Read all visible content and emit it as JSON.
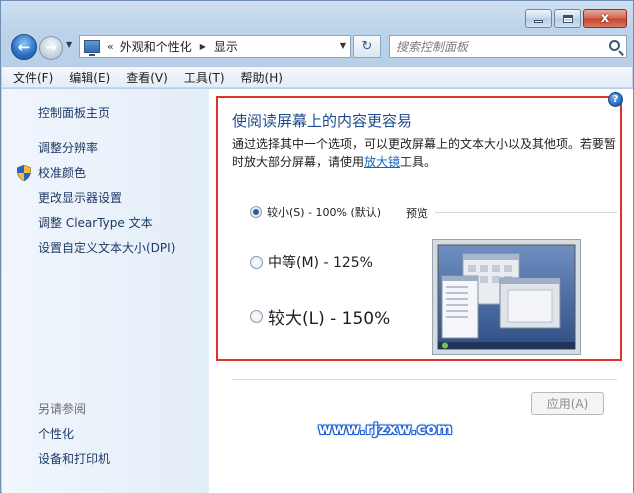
{
  "window": {
    "caption": {
      "minimize": "—",
      "maximize": "□",
      "close": "x"
    }
  },
  "nav": {
    "back_glyph": "←",
    "forward_glyph": "→",
    "dropdown_glyph": "▼",
    "address": {
      "separator": "«",
      "crumbs": [
        "外观和个性化",
        "显示"
      ],
      "crumb_arrow": "▶",
      "dropdown_glyph": "▼"
    },
    "refresh_glyph": "↻",
    "search_placeholder": "搜索控制面板"
  },
  "menu": [
    "文件(F)",
    "编辑(E)",
    "查看(V)",
    "工具(T)",
    "帮助(H)"
  ],
  "sidebar": {
    "home": "控制面板主页",
    "links": [
      "调整分辨率",
      "校准颜色",
      "更改显示器设置",
      "调整 ClearType 文本",
      "设置自定义文本大小(DPI)"
    ],
    "see_also_title": "另请参阅",
    "see_also": [
      "个性化",
      "设备和打印机"
    ]
  },
  "content": {
    "heading": "使阅读屏幕上的内容更容易",
    "description_before": "通过选择其中一个选项，可以更改屏幕上的文本大小以及其他项。若要暂时放大部分屏幕，请使用",
    "magnifier_link": "放大镜",
    "description_after": "工具。",
    "options": [
      {
        "label": "较小(S) - 100% (默认)",
        "selected": true
      },
      {
        "label": "中等(M) - 125%",
        "selected": false
      },
      {
        "label": "较大(L) - 150%",
        "selected": false
      }
    ],
    "preview_label": "预览",
    "apply_button": "应用(A)",
    "help_glyph": "?"
  },
  "watermark": "www.rjzxw.com",
  "colors": {
    "highlight_frame": "#e0312a",
    "link": "#1565c0",
    "heading": "#1c4c8c"
  }
}
